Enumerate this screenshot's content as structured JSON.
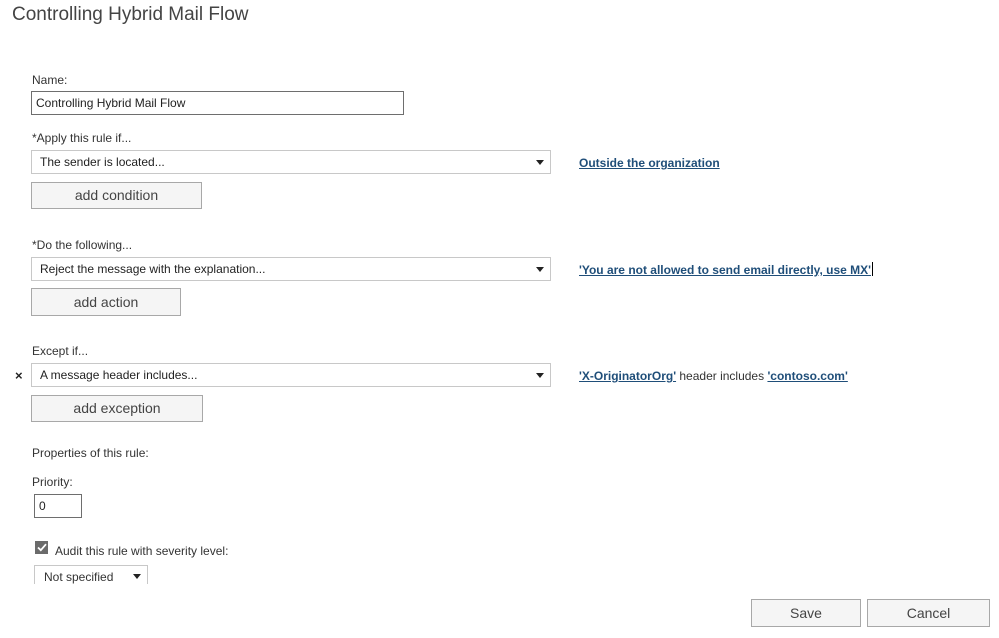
{
  "window": {
    "title": "Controlling Hybrid Mail Flow"
  },
  "name_field": {
    "label": "Name:",
    "value": "Controlling Hybrid Mail Flow"
  },
  "condition": {
    "label": "*Apply this rule if...",
    "selected": "The sender is located...",
    "value_link": "Outside the organization",
    "add_label": "add condition"
  },
  "action": {
    "label": "*Do the following...",
    "selected": "Reject the message with the explanation...",
    "value_link": "'You are not allowed to send email directly, use MX'",
    "add_label": "add action"
  },
  "exception": {
    "label": "Except if...",
    "remove_icon": "×",
    "selected": "A message header includes...",
    "header_link": "'X-OriginatorOrg'",
    "middle_text": " header includes ",
    "value_link": "'contoso.com'",
    "add_label": "add exception"
  },
  "properties": {
    "heading": "Properties of this rule:",
    "priority_label": "Priority:",
    "priority_value": "0",
    "audit_checked": true,
    "audit_label": "Audit this rule with severity level:",
    "severity_selected": "Not specified"
  },
  "footer": {
    "save_label": "Save",
    "cancel_label": "Cancel"
  },
  "colors": {
    "link": "#1f4e79",
    "checkbox": "#6b6b6b"
  }
}
